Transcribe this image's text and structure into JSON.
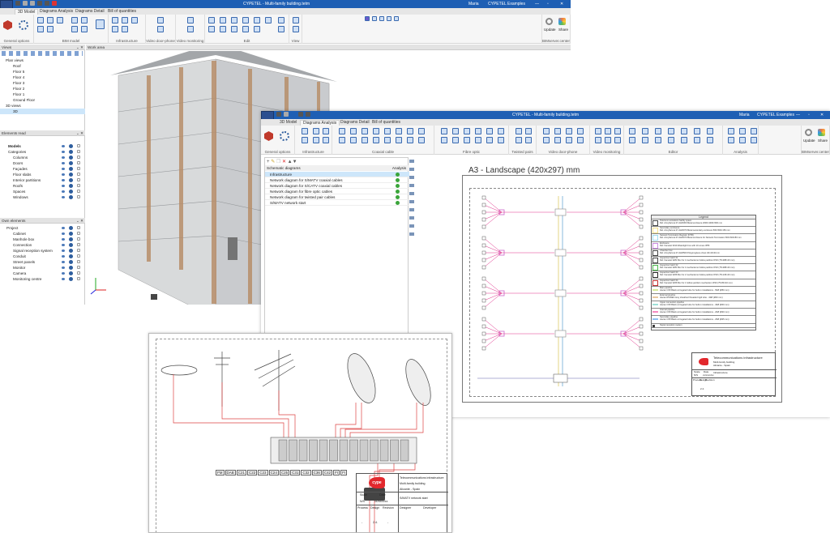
{
  "window_main": {
    "title": "CYPETEL - Multi-family building.tetm",
    "tabs": [
      "3D Model",
      "Diagrams Analysis",
      "Diagrams Detail",
      "Bill of quantities"
    ],
    "active_tab": "3D Model",
    "ribbon_groups": [
      "General options",
      "BIM model",
      "Infrastructure",
      "Video door-phone",
      "Video monitoring",
      "Edit",
      "View",
      "BIMserver.center"
    ],
    "user": "Maria",
    "project": "CYPETEL Examples",
    "update_label": "Update",
    "share_label": "Share",
    "views_panel": {
      "title": "Views",
      "items": [
        {
          "label": "Plan views",
          "level": 0
        },
        {
          "label": "Roof",
          "level": 1
        },
        {
          "label": "Floor 5",
          "level": 1
        },
        {
          "label": "Floor 4",
          "level": 1
        },
        {
          "label": "Floor 3",
          "level": 1
        },
        {
          "label": "Floor 2",
          "level": 1
        },
        {
          "label": "Floor 1",
          "level": 1
        },
        {
          "label": "Ground Floor",
          "level": 1
        },
        {
          "label": "3D views",
          "level": 0
        },
        {
          "label": "3D",
          "level": 1,
          "selected": true
        }
      ]
    },
    "elements_read_panel": {
      "title": "Elements read",
      "items": [
        "Models",
        "Categories",
        "Columns",
        "Doors",
        "Façades",
        "Floor slabs",
        "Interior partitions",
        "Roofs",
        "Spaces",
        "Windows"
      ]
    },
    "own_elements_panel": {
      "title": "Own elements",
      "items": [
        "Project",
        "Cabinet",
        "Manhole box",
        "Connection",
        "Signal reception system",
        "Conduit",
        "Street panels",
        "Monitor",
        "Camera",
        "Monitoring centre"
      ]
    },
    "work_area_label": "Work area"
  },
  "window_diagrams": {
    "title": "CYPETEL - Multi-family building.tetm",
    "tabs": [
      "3D Model",
      "Diagrams Analysis",
      "Diagrams Detail",
      "Bill of quantities"
    ],
    "active_tab": "Diagrams Analysis",
    "ribbon_groups": [
      "General options",
      "Infrastructure",
      "Coaxial cable",
      "Fibre optic",
      "Twisted pairs",
      "Video door-phone",
      "Video monitoring",
      "Editor",
      "Analysis",
      "BIMserver.center"
    ],
    "user": "Maria",
    "project": "CYPETEL Examples",
    "update_label": "Update",
    "share_label": "Share",
    "list_header": "Schematic diagrams",
    "analysis_header": "Analysis",
    "diagrams": [
      "Infrastructure",
      "Network diagram for S/MATV coaxial cables",
      "Network diagram for S/CATV coaxial cables",
      "Network diagram for fibre optic cables",
      "Network diagram for twisted pair cables",
      "S/MATV network start"
    ],
    "sheet_title": "A3 - Landscape (420x297) mm",
    "legend": {
      "title": "Legend",
      "items": [
        {
          "label": "Telecommunications facility space",
          "ref": "Ref. Armyfarrera 07-AHR300 Metal enclosure 2000×1000×500 mm",
          "color": "#ffffff"
        },
        {
          "label": "Secondary enclosure",
          "ref": "Ref. Armyfarrera 07-AHR070 Metal secondary enclosure 500×500×150 mm",
          "color": "#f3e08a"
        },
        {
          "label": "Network Termination Register (NTR)",
          "ref": "Ref. Armyfarrera 07-AHR070 Metal enclosure for Network Termination 500×600×80 mm",
          "color": "#9fdcf0"
        },
        {
          "label": "Enclosure",
          "ref": "Ref. Famatel 3010 Watertight box with 10 cones IP55",
          "color": "#c98be0"
        },
        {
          "label": "Chamber box",
          "ref": "Ref. Armyfarrera 07-AHR500 Polypropylene chest 40×40×40 cm",
          "color": "#ffffff"
        },
        {
          "label": "Inspection hatch 01",
          "ref": "Ref. Famatel 3281 Box for 4 mechanisms hollow partition IP20 (75×288×40 mm)",
          "color": "#ffffff"
        },
        {
          "label": "Inspection hatch 02",
          "ref": "Ref. Famatel 3281 Box for 4 mechanisms hollow partition IP20 (75×288×40 mm)",
          "color": "#4cb84c"
        },
        {
          "label": "Inspection hatch 03",
          "ref": "Ref. Famatel 3266 Box for 2 mechanisms hollow partition IP20 (75×145×40 mm)",
          "color": "#222222"
        },
        {
          "label": "Inspection hatch 04",
          "ref": "Ref. Famatel 3266 Box for 1 hollow partition mechanism IP20 (75×80×40 mm)",
          "color": "#c03030"
        },
        {
          "label": "Main pipeline",
          "ref": "Aiscan CS5 Black corrugated tube for built-in installations - 50Ø (Ø50 mm)",
          "color": "#d6ea9a"
        },
        {
          "label": "External pipeline",
          "ref": "Aiscan RS/RE3 Grey sheathed threaded rigid tube - 40Ø (Ø40 mm)",
          "color": "#e8c9a0"
        },
        {
          "label": "Upper connection pipeline",
          "ref": "Aiscan CS5 Black corrugated tube for built-in installations - 40Ø (Ø40 mm)",
          "color": "#9fe0d8"
        },
        {
          "label": "Internal pipeline",
          "ref": "Aiscan CS5 Black corrugated tube for built-in installations - 20Ø (Ø20 mm)",
          "color": "#f58ac0"
        },
        {
          "label": "Secondary pipeline",
          "ref": "Aiscan CS5 Black corrugated tube for built-in installations - 25Ø (Ø25 mm)",
          "color": "#8fc0f0"
        },
        {
          "label": "Signal reception system",
          "ref": "",
          "color": "#ffffff"
        }
      ]
    },
    "title_block": {
      "line1": "Telecommunications infrastructure",
      "line2": "Multi-family building",
      "line3": "Alicante - Spain",
      "scale_label": "Scale",
      "scale": "N/S",
      "date_label": "Date",
      "date": "xx/xxxx/xx",
      "process_label": "Process",
      "design_label": "Design",
      "revision_label": "Revision",
      "design": "2.4.",
      "sheet_name": "Infrastructure"
    }
  },
  "drawing_sheet": {
    "channel_labels": [
      "FM",
      "DAB",
      "C21",
      "C22",
      "C23",
      "C24",
      "C25",
      "C31",
      "C32",
      "C36",
      "C42",
      "FI",
      "FI"
    ],
    "title_block": {
      "logo_text": "cype",
      "line1": "Telecommunications infrastructure",
      "line2": "Multi-family building",
      "line3": "Alicante - Spain",
      "scale_label": "Scale",
      "scale": "N/S",
      "date_label": "Date",
      "date": "xx/xxxx/xx",
      "sheet_name": "S/MATV network start",
      "process_label": "Process",
      "design_label": "Design",
      "revision_label": "Revision",
      "process": "-",
      "design": "2.4.",
      "revision": "-",
      "designer_label": "Designer",
      "developer_label": "Developer"
    }
  },
  "colors": {
    "titlebar": "#1e5fb4",
    "ok": "#3aa53a",
    "pipe_pink": "#e0308a",
    "cype_red": "#e2282d"
  }
}
